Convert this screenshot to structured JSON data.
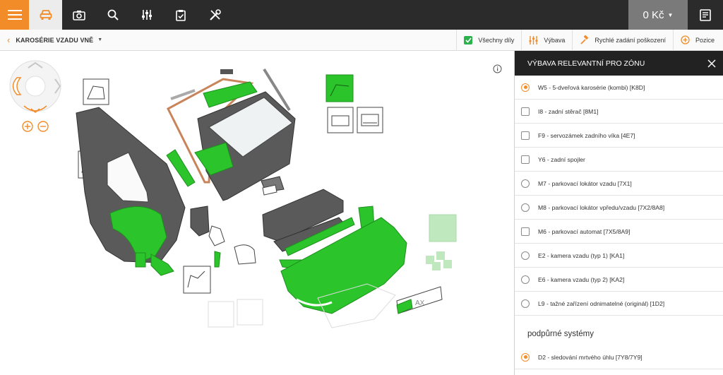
{
  "topbar": {
    "price_label": "0 Kč",
    "icons": [
      "menu-icon",
      "car-icon",
      "camera-icon",
      "search-icon",
      "sliders-icon",
      "clipboard-check-icon",
      "tools-icon",
      "chevron-down-icon",
      "receipt-icon"
    ]
  },
  "toolbar": {
    "breadcrumb_title": "KAROSÉRIE VZADU VNĚ",
    "all_parts_label": "Všechny díly",
    "equipment_label": "Výbava",
    "quick_damage_label": "Rychlé zadání poškození",
    "position_label": "Pozice"
  },
  "colors": {
    "accent": "#f28c28",
    "topbar": "#2b2b2b",
    "highlight_green": "#2bc42b",
    "part_gray": "#5a5a5a"
  },
  "panel": {
    "title": "VÝBAVA RELEVANTNÍ PRO ZÓNU",
    "options": [
      {
        "label": "W5 - 5-dveřová karosérie (kombi) [K8D]",
        "control": "radio",
        "selected": true
      },
      {
        "label": "I8 - zadní stěrač [8M1]",
        "control": "checkbox",
        "selected": false
      },
      {
        "label": "F9 - servozámek zadního víka [4E7]",
        "control": "checkbox",
        "selected": false
      },
      {
        "label": "Y6 - zadní spojler",
        "control": "checkbox",
        "selected": false
      },
      {
        "label": "M7 - parkovací lokátor vzadu [7X1]",
        "control": "radio",
        "selected": false
      },
      {
        "label": "M8 - parkovací lokátor vpředu/vzadu [7X2/8A8]",
        "control": "radio",
        "selected": false
      },
      {
        "label": "M6 - parkovací automat [7X5/8A9]",
        "control": "checkbox",
        "selected": false
      },
      {
        "label": "E2 - kamera vzadu (typ 1) [KA1]",
        "control": "radio",
        "selected": false
      },
      {
        "label": "E6 - kamera vzadu (typ 2) [KA2]",
        "control": "radio",
        "selected": false
      },
      {
        "label": "L9 - tažné zařízení odnimatelné (originál) [1D2]",
        "control": "radio",
        "selected": false
      }
    ],
    "section_title": "podpůrné systémy",
    "section_options": [
      {
        "label": "D2 - sledování mrtvého úhlu [7Y8/7Y9]",
        "control": "radio",
        "selected": true
      }
    ]
  },
  "diagram": {
    "plate_text": "AX"
  }
}
